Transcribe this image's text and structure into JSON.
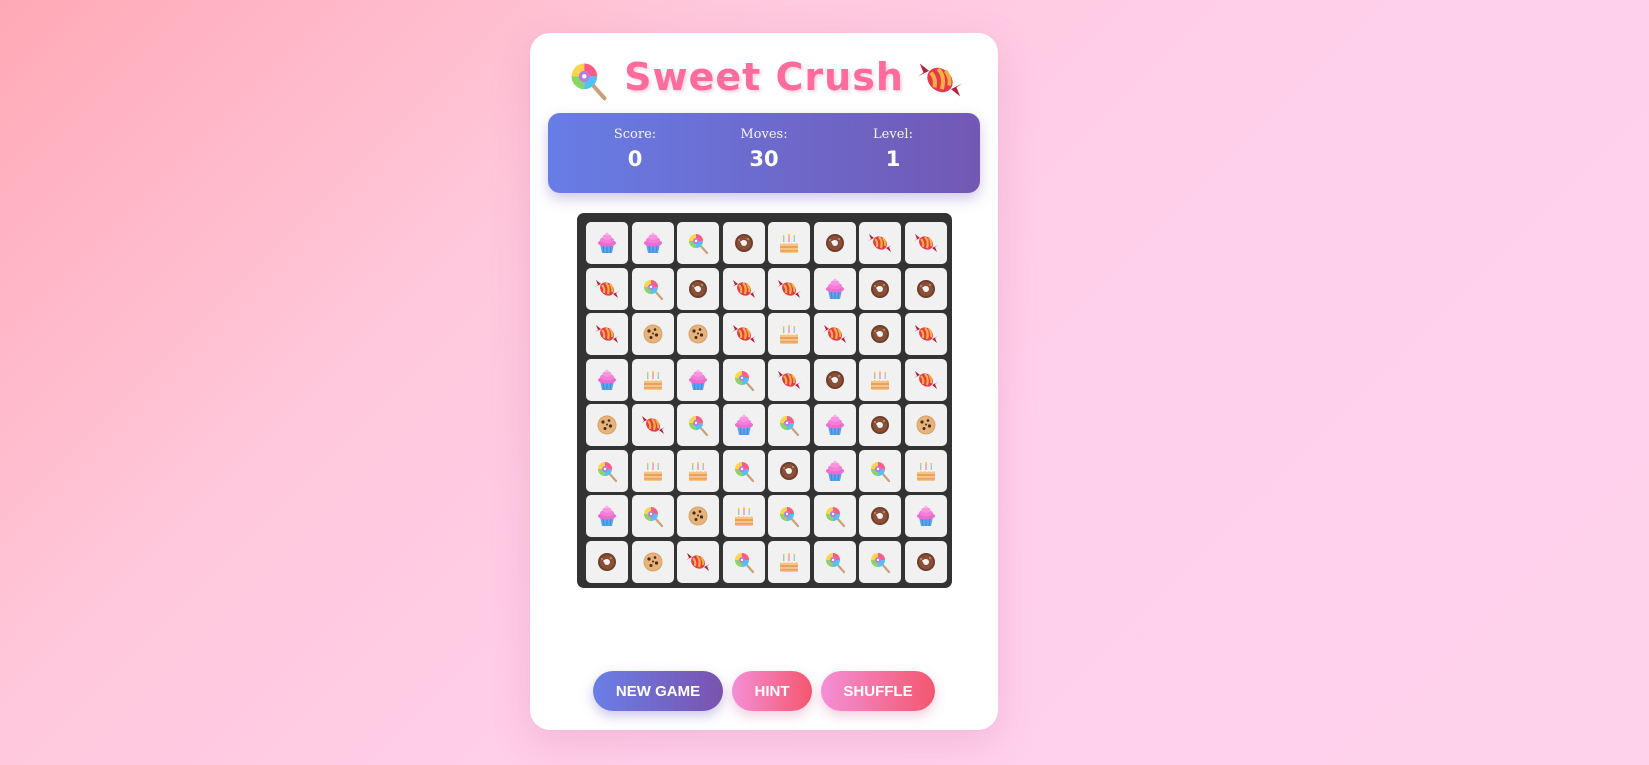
{
  "game": {
    "title": "Sweet Crush",
    "title_left_icon": "lollipop-icon",
    "title_right_icon": "candy-icon"
  },
  "stats": {
    "score_label": "Score:",
    "score_value": "0",
    "moves_label": "Moves:",
    "moves_value": "30",
    "level_label": "Level:",
    "level_value": "1"
  },
  "board": {
    "rows": 8,
    "cols": 8,
    "grid": [
      [
        "cupcake",
        "cupcake",
        "lollipop",
        "donut",
        "cake",
        "donut",
        "candy",
        "candy"
      ],
      [
        "candy",
        "lollipop",
        "donut",
        "candy",
        "candy",
        "cupcake",
        "donut",
        "donut"
      ],
      [
        "candy",
        "cookie",
        "cookie",
        "candy",
        "cake",
        "candy",
        "donut",
        "candy"
      ],
      [
        "cupcake",
        "cake",
        "cupcake",
        "lollipop",
        "candy",
        "donut",
        "cake",
        "candy"
      ],
      [
        "cookie",
        "candy",
        "lollipop",
        "cupcake",
        "lollipop",
        "cupcake",
        "donut",
        "cookie"
      ],
      [
        "lollipop",
        "cake",
        "cake",
        "lollipop",
        "donut",
        "cupcake",
        "lollipop",
        "cake"
      ],
      [
        "cupcake",
        "lollipop",
        "cookie",
        "cake",
        "lollipop",
        "lollipop",
        "donut",
        "cupcake"
      ],
      [
        "donut",
        "cookie",
        "candy",
        "lollipop",
        "cake",
        "lollipop",
        "lollipop",
        "donut"
      ]
    ]
  },
  "buttons": {
    "new_game": "NEW GAME",
    "hint": "HINT",
    "shuffle": "SHUFFLE"
  },
  "colors": {
    "title": "#ff6b9d",
    "stats_gradient_start": "#677de6",
    "stats_gradient_end": "#7258b4",
    "board_bg": "#333333",
    "cell_bg": "#f1f1f1"
  }
}
